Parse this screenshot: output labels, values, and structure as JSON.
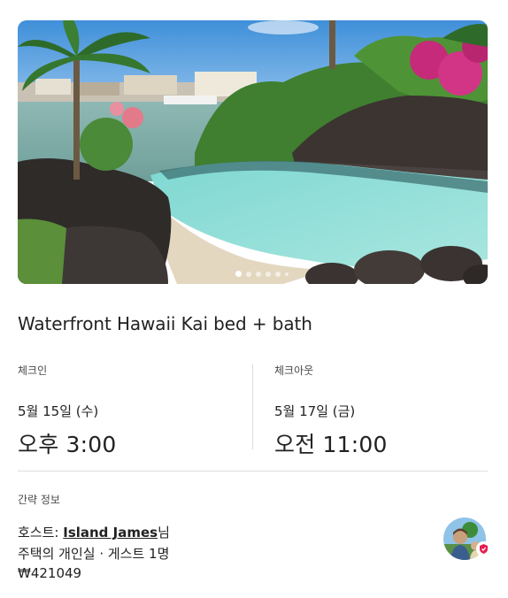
{
  "listing": {
    "photo_alt": "",
    "photo_count": 6,
    "active_photo": 1,
    "title": "Waterfront Hawaii Kai bed + bath"
  },
  "checkin": {
    "label": "체크인",
    "date": "5월 15일 (수)",
    "time": "오후 3:00"
  },
  "checkout": {
    "label": "체크아웃",
    "date": "5월 17일 (금)",
    "time": "오전 11:00"
  },
  "brief": {
    "label": "간략 정보",
    "host_prefix": "호스트: ",
    "host_name": "Island James",
    "host_suffix": "님",
    "room_info": "주택의 개인실 · 게스트 1명",
    "price": "₩421049"
  },
  "icons": {
    "avatar": "host-avatar",
    "badge": "superhost-badge-icon"
  },
  "colors": {
    "text": "#222222",
    "muted": "#4a4a4a",
    "divider": "#dddddd",
    "badge": "#e61e4d"
  }
}
